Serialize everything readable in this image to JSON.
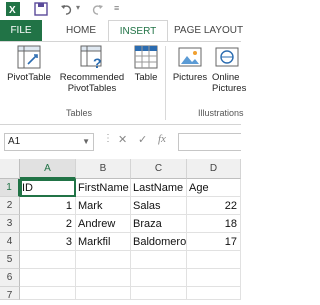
{
  "tabs": {
    "file": "FILE",
    "home": "HOME",
    "insert": "INSERT",
    "page_layout": "PAGE LAYOUT"
  },
  "ribbon": {
    "pivot_table": "PivotTable",
    "recommended_line1": "Recommended",
    "recommended_line2": "PivotTables",
    "table": "Table",
    "pictures": "Pictures",
    "online_line1": "Online",
    "online_line2": "Pictures",
    "group_tables": "Tables",
    "group_illustrations": "Illustrations"
  },
  "formula_bar": {
    "name_box": "A1",
    "cancel": "✕",
    "enter": "✓",
    "fx": "fx"
  },
  "grid": {
    "columns": [
      "A",
      "B",
      "C",
      "D"
    ],
    "rows": [
      "1",
      "2",
      "3",
      "4",
      "5",
      "6",
      "7"
    ],
    "cells": [
      [
        "ID",
        "FirstName",
        "LastName",
        "Age"
      ],
      [
        "1",
        "Mark",
        "Salas",
        "22"
      ],
      [
        "2",
        "Andrew",
        "Braza",
        "18"
      ],
      [
        "3",
        "Markfil",
        "Baldomero",
        "17"
      ]
    ]
  },
  "colors": {
    "accent": "#217346"
  }
}
